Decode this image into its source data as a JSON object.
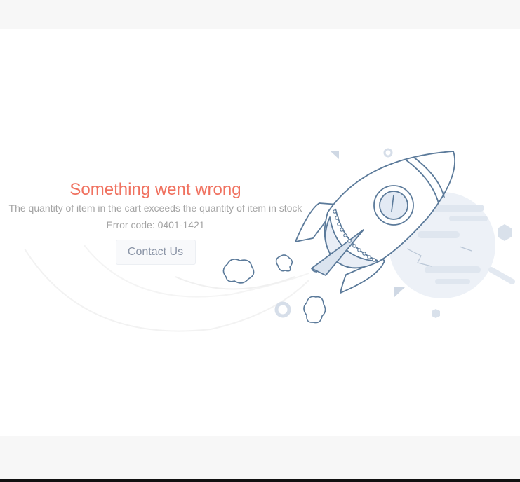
{
  "error": {
    "title": "Something went wrong",
    "message": "The quantity of item in the cart exceeds the quantity of item in stock",
    "code": "Error code: 0401-1421",
    "contact_label": "Contact Us"
  },
  "colors": {
    "title": "#f0715f",
    "text": "#a3a3a3",
    "illustration_stroke": "#5b7a9a",
    "illustration_fill": "#e9eef6"
  }
}
